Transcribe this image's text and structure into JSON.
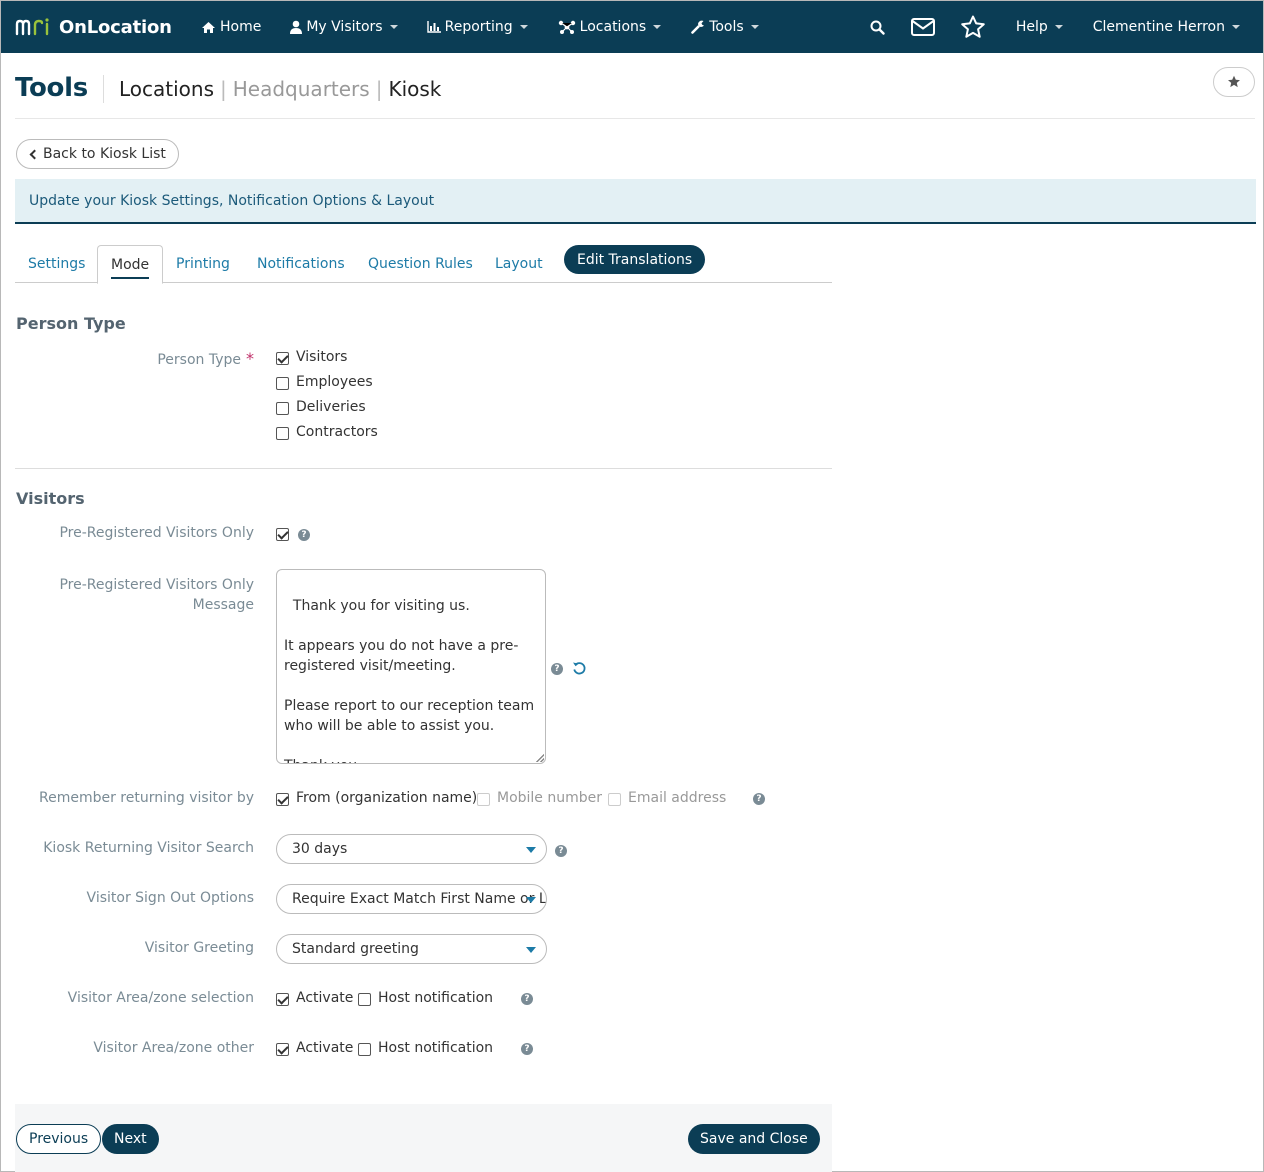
{
  "nav": {
    "brand": "OnLocation",
    "items": [
      {
        "label": "Home",
        "icon": "home-icon"
      },
      {
        "label": "My Visitors",
        "icon": "user-icon"
      },
      {
        "label": "Reporting",
        "icon": "bar-chart-icon"
      },
      {
        "label": "Locations",
        "icon": "network-icon"
      },
      {
        "label": "Tools",
        "icon": "wrench-icon"
      }
    ],
    "help": "Help",
    "user": "Clementine Herron"
  },
  "header": {
    "title": "Tools",
    "breadcrumb": [
      "Locations",
      "Headquarters",
      "Kiosk"
    ]
  },
  "back_button": "Back to Kiosk List",
  "info_bar": "Update your Kiosk Settings, Notification Options & Layout",
  "tabs": [
    "Settings",
    "Mode",
    "Printing",
    "Notifications",
    "Question Rules",
    "Layout"
  ],
  "active_tab": "Mode",
  "edit_translations": "Edit Translations",
  "person_type_section": {
    "title": "Person Type",
    "label": "Person Type",
    "required_mark": "*",
    "options": [
      {
        "label": "Visitors",
        "checked": true
      },
      {
        "label": "Employees",
        "checked": false
      },
      {
        "label": "Deliveries",
        "checked": false
      },
      {
        "label": "Contractors",
        "checked": false
      }
    ]
  },
  "visitors_section": {
    "title": "Visitors",
    "pre_registered_only_label": "Pre-Registered Visitors Only",
    "pre_registered_only_checked": true,
    "message_label_line1": "Pre-Registered Visitors Only",
    "message_label_line2": "Message",
    "message_value": "Thank you for visiting us.\n\nIt appears you do not have a pre-registered visit/meeting.\n\nPlease report to our reception team who will be able to assist you.\n\nThank you",
    "remember_label": "Remember returning visitor by",
    "remember_options": [
      {
        "label": "From (organization name)",
        "checked": true,
        "disabled": false
      },
      {
        "label": "Mobile number",
        "checked": false,
        "disabled": true
      },
      {
        "label": "Email address",
        "checked": false,
        "disabled": true
      }
    ],
    "search_label": "Kiosk Returning Visitor Search",
    "search_value": "30 days",
    "signout_label": "Visitor Sign Out Options",
    "signout_value": "Require Exact Match First Name or La",
    "greeting_label": "Visitor Greeting",
    "greeting_value": "Standard greeting",
    "area_selection_label": "Visitor Area/zone selection",
    "area_other_label": "Visitor Area/zone other",
    "activate_label": "Activate",
    "host_notification_label": "Host notification"
  },
  "footer": {
    "previous": "Previous",
    "next": "Next",
    "save_close": "Save and Close"
  },
  "colors": {
    "primary": "#0b3d55",
    "link": "#1d7ba7",
    "info_bg": "#e3f0f4"
  }
}
